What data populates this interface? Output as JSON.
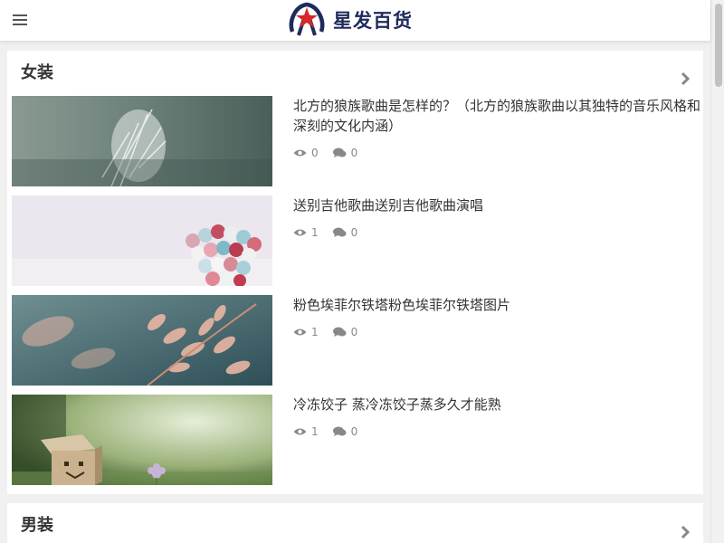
{
  "header": {
    "brand_name": "星发百货",
    "menu_icon": "menu-icon",
    "logo_icon": "logo-star-icon"
  },
  "sections": [
    {
      "title": "女装",
      "more_icon": "chevron-right-icon",
      "articles": [
        {
          "title": "北方的狼族歌曲是怎样的？（北方的狼族歌曲以其独特的音乐风格和深刻的文化内涵）",
          "views": "0",
          "comments": "0"
        },
        {
          "title": "送别吉他歌曲送别吉他歌曲演唱",
          "views": "1",
          "comments": "0"
        },
        {
          "title": "粉色埃菲尔铁塔粉色埃菲尔铁塔图片",
          "views": "1",
          "comments": "0"
        },
        {
          "title": "冷冻饺子 蒸冷冻饺子蒸多久才能熟",
          "views": "1",
          "comments": "0"
        }
      ]
    },
    {
      "title": "男装",
      "more_icon": "chevron-right-icon"
    }
  ],
  "colors": {
    "brand": "#1f2a5c",
    "accent": "#d9262a",
    "meta": "#888888"
  }
}
